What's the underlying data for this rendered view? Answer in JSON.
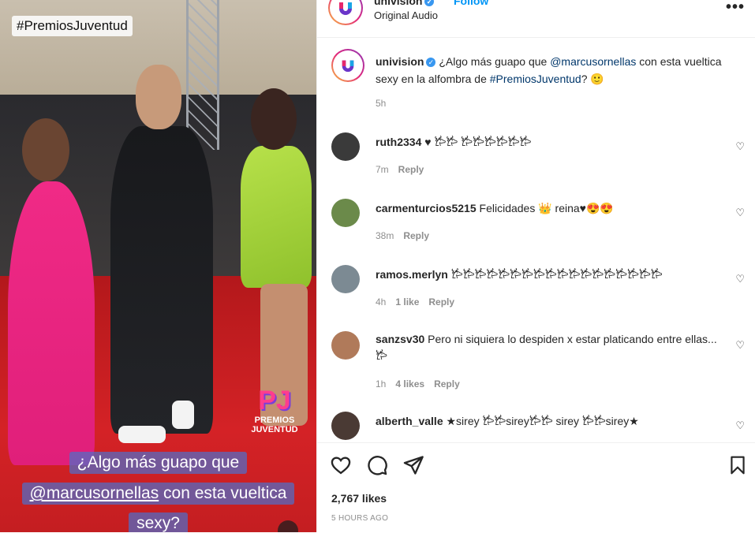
{
  "media": {
    "hashtag_overlay": "#PremiosJuventud",
    "logo_text_top": "PJ",
    "logo_text_line1": "PREMIOS",
    "logo_text_line2": "JUVENTUD",
    "caption_line1": "¿Algo más guapo que",
    "caption_line2_mention": "@marcusornellas",
    "caption_line2_rest": " con esta vueltica",
    "caption_line3": "sexy?"
  },
  "header": {
    "username": "univision",
    "follow_label": "Follow",
    "audio": "Original Audio",
    "more_glyph": "•••"
  },
  "post": {
    "username": "univision",
    "text_prefix": " ¿Algo más guapo que ",
    "mention": "@marcusornellas",
    "text_middle": " con esta vueltica sexy en la alfombra de ",
    "hashtag": "#PremiosJuventud",
    "text_suffix": "? 🙂",
    "time": "5h"
  },
  "comments": [
    {
      "user": "ruth2334",
      "text": " ♥ 𐂂𐂂 𐂂𐂂𐂂𐂂𐂂𐂂",
      "time": "7m",
      "likes": "",
      "reply": "Reply",
      "avatar_color": "#3a3a3a"
    },
    {
      "user": "carmenturcios5215",
      "text": " Felicidades 👑 reina♥😍😍",
      "time": "38m",
      "likes": "",
      "reply": "Reply",
      "avatar_color": "#6b8a4a"
    },
    {
      "user": "ramos.merlyn",
      "text": " 𐂂𐂂𐂂𐂂𐂂𐂂𐂂𐂂𐂂𐂂𐂂𐂂𐂂𐂂𐂂𐂂𐂂𐂂",
      "time": "4h",
      "likes": "1 like",
      "reply": "Reply",
      "avatar_color": "#7c8a93"
    },
    {
      "user": "sanzsv30",
      "text": " Pero ni siquiera lo despiden x estar platicando entre ellas... 𐂂",
      "time": "1h",
      "likes": "4 likes",
      "reply": "Reply",
      "avatar_color": "#b07a5a"
    },
    {
      "user": "alberth_valle",
      "text": " ★sirey 𐂂𐂂sirey𐂂𐂂 sirey 𐂂𐂂sirey★",
      "time": "",
      "likes": "",
      "reply": "",
      "avatar_color": "#4a3a34"
    }
  ],
  "actions": {
    "likes": "2,767 likes",
    "posted": "5 HOURS AGO"
  }
}
